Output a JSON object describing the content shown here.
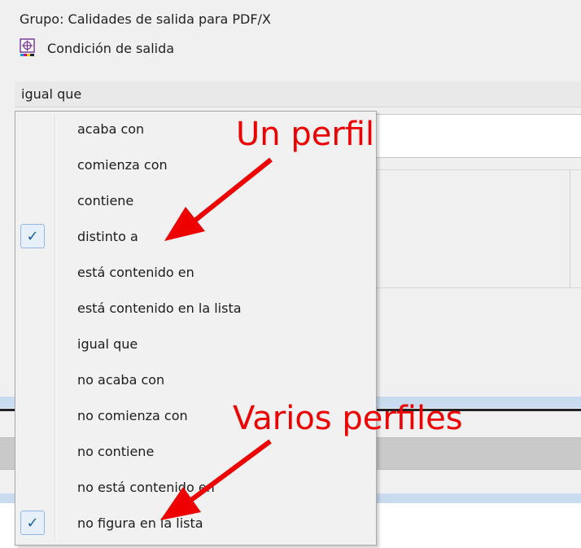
{
  "header": {
    "group_label": "Grupo:  Calidades de salida para PDF/X",
    "condition_label": "Condición de salida",
    "condition_icon": "output-condition-icon"
  },
  "operator_select": {
    "value": "igual que"
  },
  "dropdown": {
    "items": [
      {
        "label": "acaba con",
        "checked": false
      },
      {
        "label": "comienza con",
        "checked": false
      },
      {
        "label": "contiene",
        "checked": false
      },
      {
        "label": "distinto a",
        "checked": true
      },
      {
        "label": "está contenido en",
        "checked": false
      },
      {
        "label": "está contenido en la lista",
        "checked": false
      },
      {
        "label": "igual que",
        "checked": false
      },
      {
        "label": "no acaba con",
        "checked": false
      },
      {
        "label": "no comienza con",
        "checked": false
      },
      {
        "label": "no contiene",
        "checked": false
      },
      {
        "label": "no está contenido en",
        "checked": false
      },
      {
        "label": "no figura en la lista",
        "checked": true
      }
    ],
    "check_glyph": "✓"
  },
  "annotations": {
    "one": "Un perfil",
    "two": "Varios perfiles",
    "color": "#ee0000"
  },
  "colors": {
    "check_accent": "#1f5ea8",
    "selection_band": "#c9dbef"
  }
}
